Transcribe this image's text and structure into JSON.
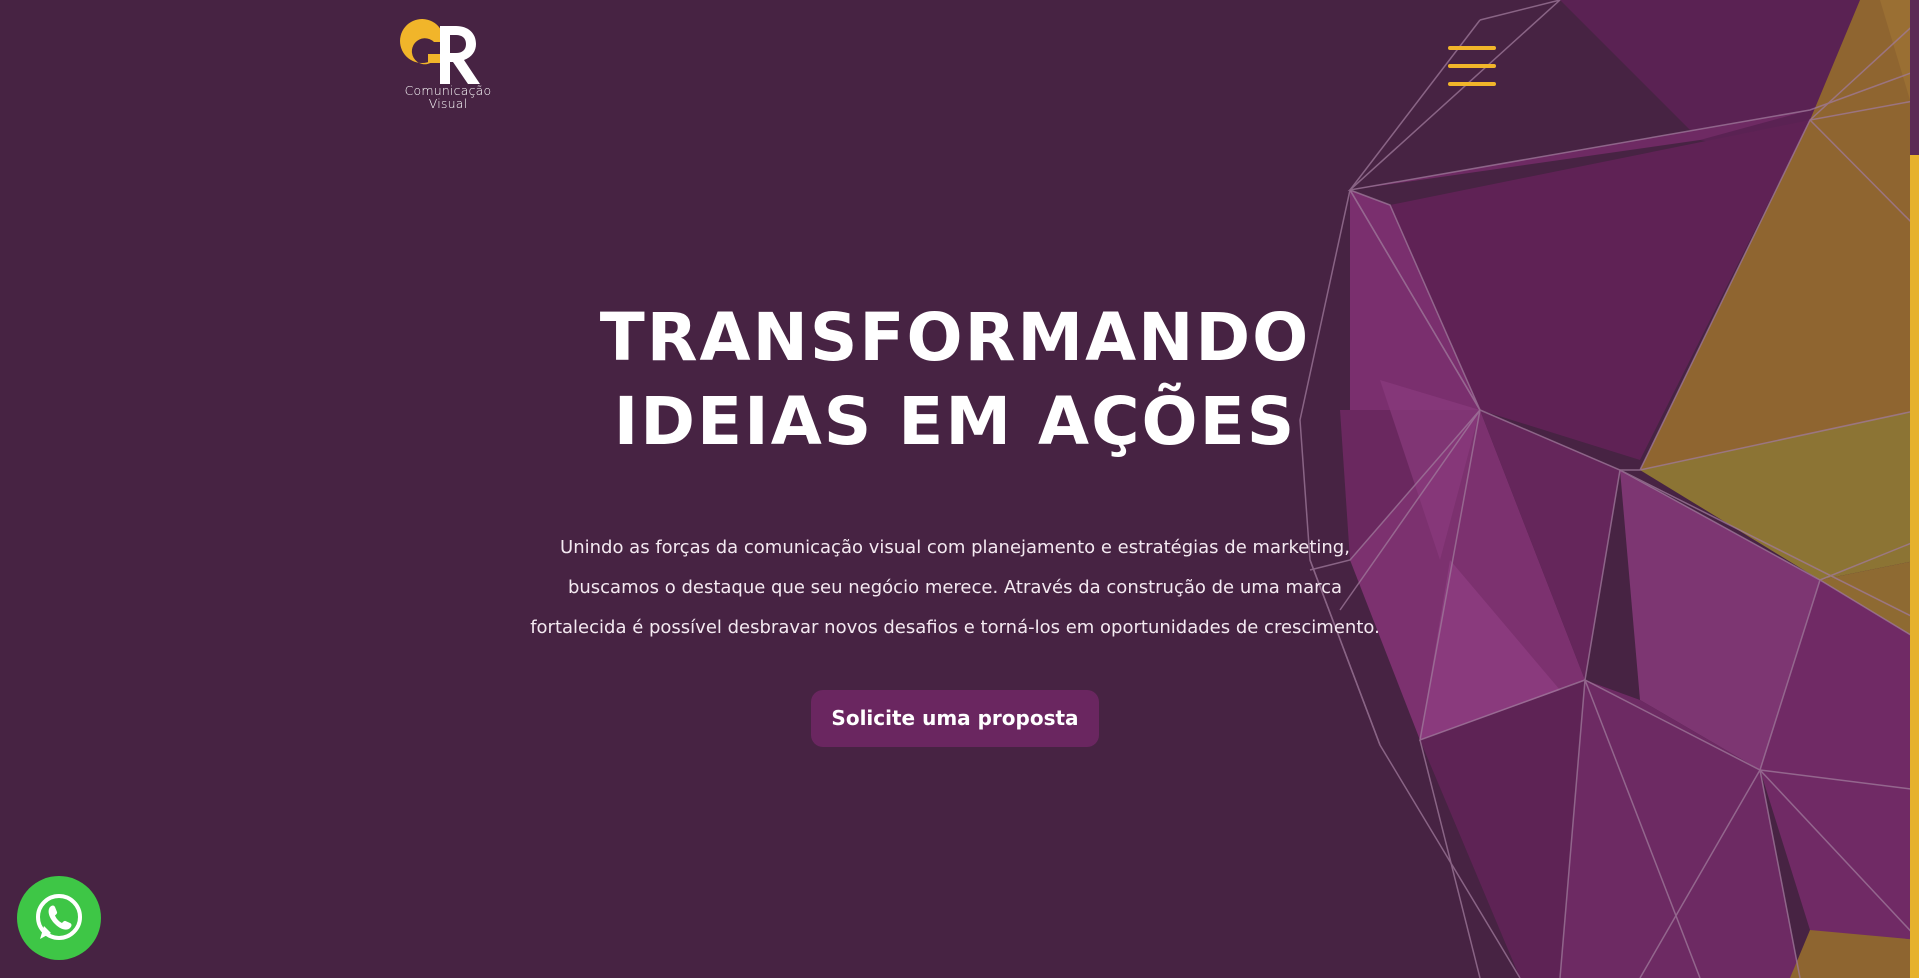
{
  "brand": {
    "logo_letters": "GR",
    "caption_line1": "Comunicação",
    "caption_line2": "Visual",
    "accent_color": "#f1b52a",
    "background_color": "#472343",
    "primary_color": "#6a2660"
  },
  "header": {
    "menu_icon": "hamburger-menu-icon"
  },
  "hero": {
    "title_line1": "TRANSFORMANDO",
    "title_line2": "IDEIAS EM AÇÕES",
    "text_line1": "Unindo as forças da comunicação visual com planejamento e estratégias de marketing,",
    "text_line2": "buscamos o destaque que seu negócio merece. Através da construção de uma marca",
    "text_line3": "fortalecida é possível desbravar novos desafios e torná-los em oportunidades de crescimento.",
    "cta_label": "Solicite uma proposta"
  },
  "floating": {
    "whatsapp_icon": "whatsapp-icon",
    "whatsapp_color": "#3ec646"
  }
}
